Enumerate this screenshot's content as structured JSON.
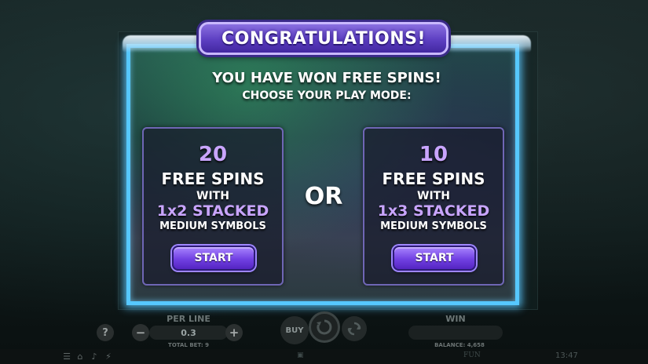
{
  "dialog": {
    "title": "CONGRATULATIONS!",
    "headline": "YOU HAVE WON FREE SPINS!",
    "subline": "CHOOSE YOUR PLAY MODE:",
    "separator": "OR",
    "options": [
      {
        "count": "20",
        "free_spins": "FREE SPINS",
        "with": "WITH",
        "stacked": "1x2 STACKED",
        "medium": "MEDIUM SYMBOLS",
        "start_label": "START"
      },
      {
        "count": "10",
        "free_spins": "FREE SPINS",
        "with": "WITH",
        "stacked": "1x3 STACKED",
        "medium": "MEDIUM SYMBOLS",
        "start_label": "START"
      }
    ]
  },
  "controls": {
    "help": "?",
    "per_line_label": "PER LINE",
    "per_line_value": "0.3",
    "minus": "−",
    "plus": "+",
    "total_bet": "TOTAL BET: 9",
    "buy_label": "BUY",
    "win_label": "WIN",
    "balance": "BALANCE: 4,658"
  },
  "statusbar": {
    "fun_label": "FUN",
    "time": "13:47"
  },
  "colors": {
    "frame_glow": "#56c8ff",
    "accent_purple": "#c9a5ff",
    "button_purple": "#7140e2"
  }
}
